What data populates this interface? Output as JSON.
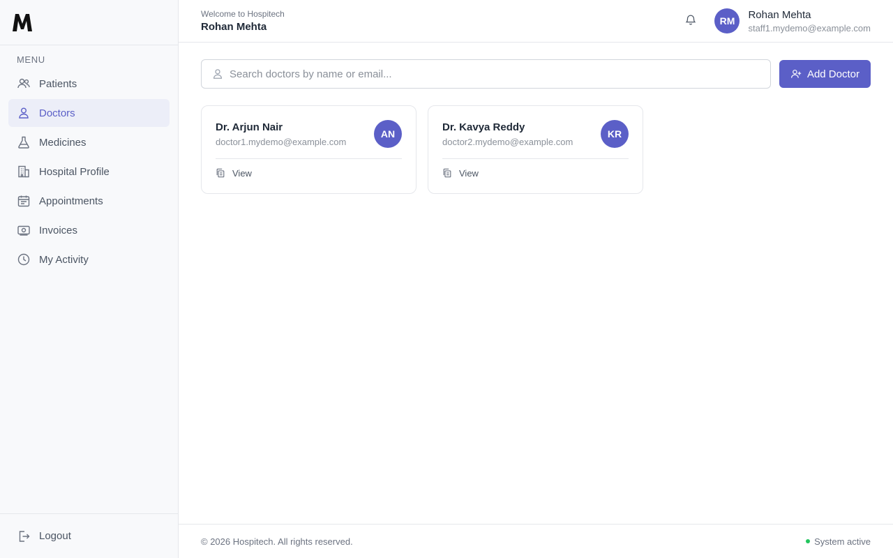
{
  "brand": {
    "logo_letter": "M",
    "logo_icon": "m-logo-icon"
  },
  "sidebar": {
    "heading": "MENU",
    "items": [
      {
        "label": "Patients",
        "icon": "users-icon",
        "active": false
      },
      {
        "label": "Doctors",
        "icon": "user-icon",
        "active": true
      },
      {
        "label": "Medicines",
        "icon": "flask-icon",
        "active": false
      },
      {
        "label": "Hospital Profile",
        "icon": "building-icon",
        "active": false
      },
      {
        "label": "Appointments",
        "icon": "calendar-icon",
        "active": false
      },
      {
        "label": "Invoices",
        "icon": "banknote-icon",
        "active": false
      },
      {
        "label": "My Activity",
        "icon": "clock-icon",
        "active": false
      }
    ],
    "logout_label": "Logout"
  },
  "header": {
    "welcome_text": "Welcome to Hospitech",
    "welcome_name": "Rohan Mehta",
    "user": {
      "initials": "RM",
      "name": "Rohan Mehta",
      "email": "staff1.mydemo@example.com"
    }
  },
  "toolbar": {
    "search_placeholder": "Search doctors by name or email...",
    "search_value": "",
    "add_button_label": "Add Doctor"
  },
  "doctors": [
    {
      "name": "Dr. Arjun Nair",
      "email": "doctor1.mydemo@example.com",
      "initials": "AN",
      "view_label": "View"
    },
    {
      "name": "Dr. Kavya Reddy",
      "email": "doctor2.mydemo@example.com",
      "initials": "KR",
      "view_label": "View"
    }
  ],
  "footer": {
    "copyright": "© 2026 Hospitech. All rights reserved.",
    "status": "System active"
  },
  "colors": {
    "accent": "#5b5fc7",
    "active_bg": "#eceef8",
    "status_green": "#22c55e"
  }
}
